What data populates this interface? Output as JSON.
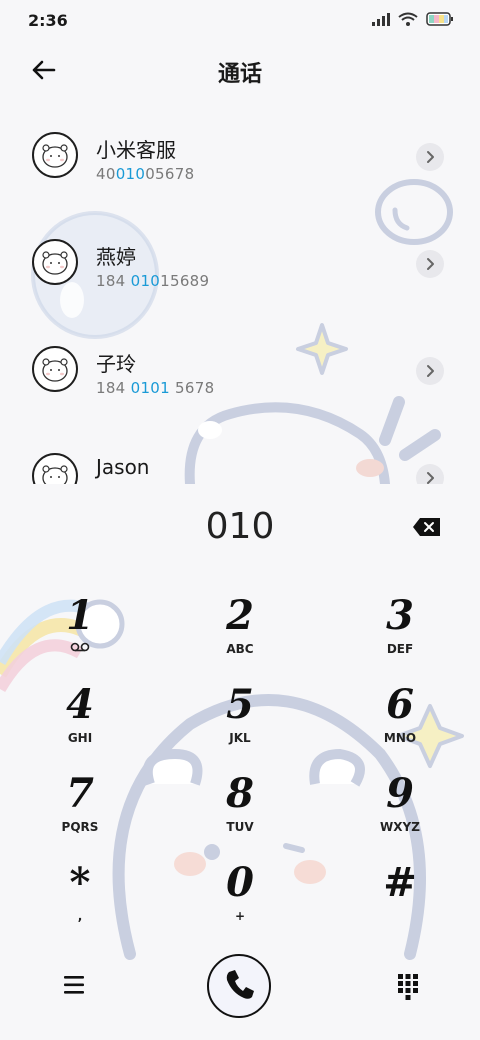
{
  "status_bar": {
    "time": "2:36",
    "icons": [
      "signal-icon",
      "wifi-icon",
      "battery-icon"
    ]
  },
  "header": {
    "title": "通话",
    "back_icon": "back-arrow-icon"
  },
  "contacts": [
    {
      "name": "小米客服",
      "number_pre": "40",
      "number_match": "010",
      "number_post": "05678"
    },
    {
      "name": "燕婷",
      "number_pre": "184 ",
      "number_match": "010",
      "number_post": "15689"
    },
    {
      "name": "子玲",
      "number_pre": "184 ",
      "number_match": "0101",
      "number_post": " 5678"
    },
    {
      "name": "Jason",
      "number_pre": "",
      "number_match": "",
      "number_post": ""
    }
  ],
  "dialer": {
    "entry": "010",
    "keys": [
      {
        "digit": "1",
        "letters": ""
      },
      {
        "digit": "2",
        "letters": "ABC"
      },
      {
        "digit": "3",
        "letters": "DEF"
      },
      {
        "digit": "4",
        "letters": "GHI"
      },
      {
        "digit": "5",
        "letters": "JKL"
      },
      {
        "digit": "6",
        "letters": "MNO"
      },
      {
        "digit": "7",
        "letters": "PQRS"
      },
      {
        "digit": "8",
        "letters": "TUV"
      },
      {
        "digit": "9",
        "letters": "WXYZ"
      },
      {
        "digit": "*",
        "letters": ","
      },
      {
        "digit": "0",
        "letters": "+"
      },
      {
        "digit": "#",
        "letters": ""
      }
    ]
  },
  "colors": {
    "accent": "#1a9ad6",
    "background": "#f7f7f9",
    "chevron_bg": "#e8e8ec",
    "decor": "#c9cfe0"
  }
}
